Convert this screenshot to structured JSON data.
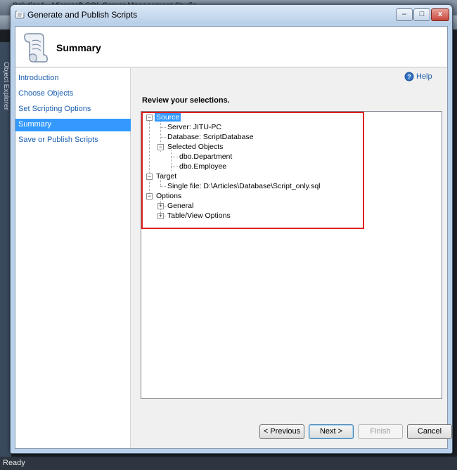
{
  "background_app": {
    "title": "Solution1 - Microsoft SQL Server Management Studio",
    "object_explorer_label": "Object Explorer",
    "status": "Ready"
  },
  "dialog": {
    "title": "Generate and Publish Scripts",
    "window_buttons": {
      "minimize": "–",
      "maximize": "□",
      "close": "x"
    },
    "header_title": "Summary",
    "help_label": "Help",
    "review_label": "Review your selections.",
    "nav": [
      {
        "label": "Introduction"
      },
      {
        "label": "Choose Objects"
      },
      {
        "label": "Set Scripting Options"
      },
      {
        "label": "Summary",
        "selected": true
      },
      {
        "label": "Save or Publish Scripts"
      }
    ],
    "tree": {
      "source": {
        "label": "Source",
        "server": "Server: JITU-PC",
        "database": "Database: ScriptDatabase",
        "selected_objects": {
          "label": "Selected Objects",
          "items": [
            "dbo.Department",
            "dbo.Employee"
          ]
        }
      },
      "target": {
        "label": "Target",
        "single_file": "Single file: D:\\Articles\\Database\\Script_only.sql"
      },
      "options": {
        "label": "Options",
        "general": "General",
        "table_view": "Table/View Options"
      }
    },
    "buttons": {
      "previous": "< Previous",
      "next": "Next >",
      "finish": "Finish",
      "cancel": "Cancel"
    }
  },
  "colors": {
    "selection": "#3399ff",
    "link": "#1c5fae",
    "highlight_border": "#e02020"
  }
}
